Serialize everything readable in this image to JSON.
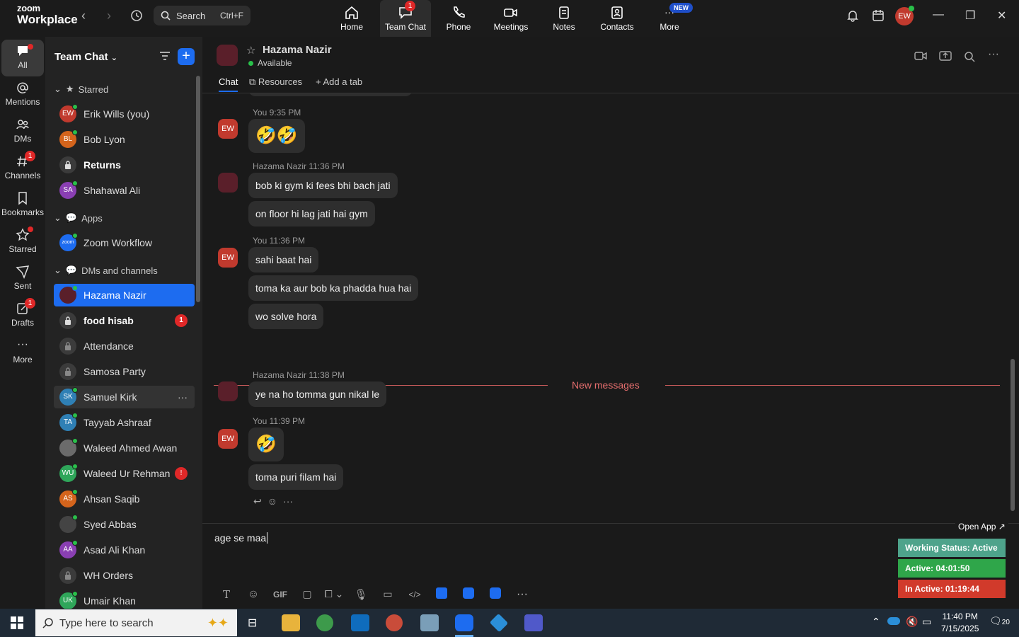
{
  "app": {
    "logo_line1": "zoom",
    "logo_line2": "Workplace"
  },
  "search": {
    "label": "Search",
    "shortcut": "Ctrl+F"
  },
  "nav": [
    {
      "label": "Home"
    },
    {
      "label": "Team Chat",
      "badge": "1"
    },
    {
      "label": "Phone"
    },
    {
      "label": "Meetings"
    },
    {
      "label": "Notes"
    },
    {
      "label": "Contacts"
    },
    {
      "label": "More",
      "badge": "NEW"
    }
  ],
  "user": {
    "initials": "EW"
  },
  "rail": [
    {
      "label": "All"
    },
    {
      "label": "Mentions"
    },
    {
      "label": "DMs"
    },
    {
      "label": "Channels",
      "badge": "1"
    },
    {
      "label": "Bookmarks"
    },
    {
      "label": "Starred"
    },
    {
      "label": "Sent"
    },
    {
      "label": "Drafts",
      "badge": "1"
    },
    {
      "label": "More"
    }
  ],
  "sidebar": {
    "title": "Team Chat",
    "sections": {
      "starred": "Starred",
      "apps": "Apps",
      "dms": "DMs and channels"
    },
    "starred": [
      {
        "initials": "EW",
        "name": "Erik Wills (you)",
        "color": "#c13a2e"
      },
      {
        "initials": "BL",
        "name": "Bob Lyon",
        "color": "#d4641c"
      },
      {
        "name": "Returns"
      },
      {
        "initials": "SA",
        "name": "Shahawal Ali",
        "color": "#8a3fb3"
      }
    ],
    "apps": [
      {
        "name": "Zoom Workflow",
        "initials": "zoom"
      }
    ],
    "dms": [
      {
        "name": "Hazama Nazir"
      },
      {
        "name": "food hisab",
        "badge": "1"
      },
      {
        "name": "Attendance"
      },
      {
        "name": "Samosa Party"
      },
      {
        "initials": "SK",
        "name": "Samuel Kirk",
        "color": "#2f80b5"
      },
      {
        "initials": "TA",
        "name": "Tayyab Ashraaf",
        "color": "#2f80b5"
      },
      {
        "name": "Waleed Ahmed Awan"
      },
      {
        "initials": "WU",
        "name": "Waleed Ur Rehman",
        "color": "#2fa65a",
        "badge": "!"
      },
      {
        "initials": "AS",
        "name": "Ahsan Saqib",
        "color": "#d4641c"
      },
      {
        "name": "Syed Abbas"
      },
      {
        "initials": "AA",
        "name": "Asad Ali Khan",
        "color": "#8a3fb3"
      },
      {
        "name": "WH Orders"
      },
      {
        "initials": "UK",
        "name": "Umair Khan",
        "color": "#2fa65a"
      }
    ]
  },
  "chat": {
    "name": "Hazama Nazir",
    "status": "Available",
    "tabs": [
      "Chat",
      "Resources",
      "Add a tab"
    ],
    "messages": {
      "m1_meta": "You 9:35 PM",
      "m1_emoji": "🤣🤣",
      "m2_meta": "Hazama Nazir 11:36 PM",
      "m2_a": "bob ki gym ki fees bhi bach jati",
      "m2_b": "on floor hi lag jati hai gym",
      "m3_meta": "You 11:36 PM",
      "m3_a": "sahi baat hai",
      "m3_b": "toma ka aur bob ka phadda hua hai",
      "m3_c": "wo solve hora",
      "new_label": "New messages",
      "m4_meta": "Hazama Nazir 11:38 PM",
      "m4_a": "ye na ho tomma gun nikal le",
      "m5_meta": "You 11:39 PM",
      "m5_emoji": "🤣",
      "m5_b": "toma puri filam hai"
    },
    "composer_text": "age se maa",
    "toolbar_gif": "GIF"
  },
  "widget": {
    "open_app": "Open App ↗",
    "working": "Working Status: Active",
    "active": "Active: 04:01:50",
    "inactive": "In Active: 01:19:44"
  },
  "taskbar": {
    "search_placeholder": "Type here to search",
    "time": "11:40 PM",
    "date": "7/15/2025",
    "notif": "20"
  }
}
